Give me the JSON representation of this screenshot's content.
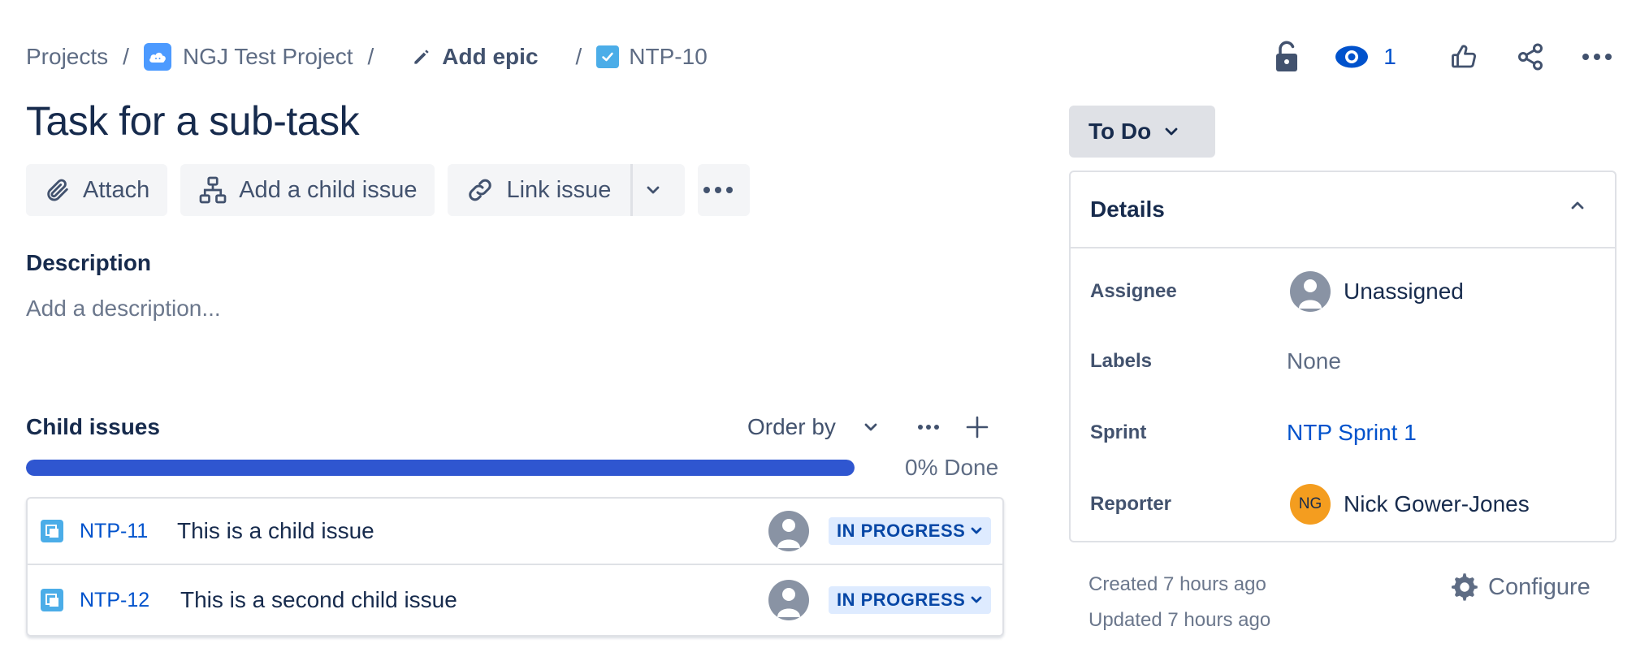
{
  "breadcrumb": {
    "projects": "Projects",
    "separator": "/",
    "project_name": "NGJ Test Project",
    "project_icon": "cloud-project-icon",
    "add_epic": "Add epic",
    "issue_key": "NTP-10"
  },
  "top_actions": {
    "watchers_count": "1",
    "icons": [
      "lock-icon",
      "eye-icon",
      "thumbs-up-icon",
      "share-icon",
      "more-icon"
    ]
  },
  "issue": {
    "title": "Task for a sub-task"
  },
  "toolbar": {
    "attach": "Attach",
    "add_child": "Add a child issue",
    "link_issue": "Link issue"
  },
  "description": {
    "label": "Description",
    "placeholder": "Add a description..."
  },
  "child_issues": {
    "label": "Child issues",
    "order_by": "Order by",
    "progress_percent": 0,
    "progress_label": "0% Done",
    "items": [
      {
        "key": "NTP-11",
        "summary": "This is a child issue",
        "status": "IN PROGRESS"
      },
      {
        "key": "NTP-12",
        "summary": "This is a second child issue",
        "status": "IN PROGRESS"
      }
    ]
  },
  "status": {
    "label": "To Do"
  },
  "details": {
    "header": "Details",
    "assignee_label": "Assignee",
    "assignee_value": "Unassigned",
    "labels_label": "Labels",
    "labels_value": "None",
    "sprint_label": "Sprint",
    "sprint_value": "NTP Sprint 1",
    "reporter_label": "Reporter",
    "reporter_initials": "NG",
    "reporter_value": "Nick Gower-Jones"
  },
  "meta": {
    "created": "Created 7 hours ago",
    "updated": "Updated 7 hours ago",
    "configure": "Configure"
  },
  "colors": {
    "link": "#0052cc",
    "progress": "#2f56d0",
    "lozenge_bg": "#deebff",
    "lozenge_text": "#0747a6",
    "reporter_avatar": "#f49d1f"
  }
}
